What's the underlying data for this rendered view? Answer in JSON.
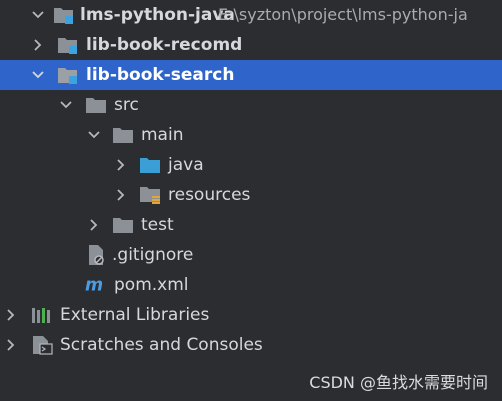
{
  "project_tree": {
    "root": {
      "name": "lms-python-java",
      "path": "E:\\syzton\\project\\lms-python-ja"
    },
    "items": [
      {
        "label": "lib-book-recomd"
      },
      {
        "label": "lib-book-search"
      },
      {
        "label": "src"
      },
      {
        "label": "main"
      },
      {
        "label": "java"
      },
      {
        "label": "resources"
      },
      {
        "label": "test"
      },
      {
        "label": ".gitignore"
      },
      {
        "label": "pom.xml"
      },
      {
        "label": "External Libraries"
      },
      {
        "label": "Scratches and Consoles"
      }
    ]
  },
  "watermark": "CSDN @鱼找水需要时间",
  "colors": {
    "background": "#2b2d30",
    "selection": "#2f65ca",
    "folder": "#8c9197",
    "module_badge": "#3ba4e0",
    "source_folder": "#3a9fd6"
  }
}
